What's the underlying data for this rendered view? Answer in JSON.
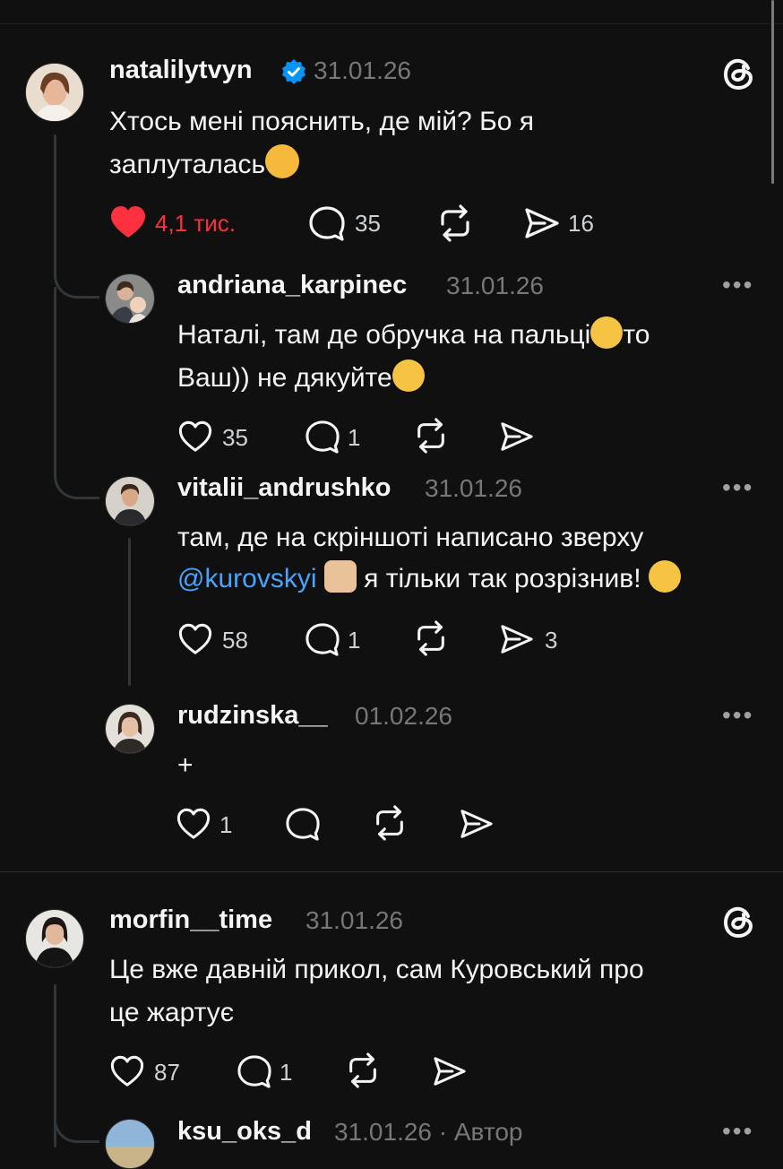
{
  "colors": {
    "background": "#101010",
    "text": "#f3f5f7",
    "muted": "#777777",
    "like_red": "#ff3040",
    "verified_blue": "#0095f6",
    "mention_blue": "#4aa3ff"
  },
  "threads": [
    {
      "username": "natalilytvyn",
      "verified": true,
      "date": "31.01.26",
      "text_line1": "Хтось мені пояснить, де мій? Бо я",
      "text_line2": "заплуталась",
      "emoji": "weary-face",
      "likes": "4,1 тис.",
      "replies": "35",
      "shares": "16",
      "liked": true,
      "comments": [
        {
          "username": "andriana_karpinec",
          "date": "31.01.26",
          "text_line1a": "Наталі, там де обручка на пальці",
          "text_line1b": "то",
          "text_line2": "Ваш)) не дякуйте",
          "likes": "35",
          "replies": "1"
        },
        {
          "username": "vitalii_andrushko",
          "date": "31.01.26",
          "text_line1": "там, де на скріншоті написано зверху",
          "mention": "@kurovskyi",
          "text_line2": "я тільки так розрізнив!",
          "likes": "58",
          "replies": "1",
          "shares": "3"
        },
        {
          "username": "rudzinska__",
          "date": "01.02.26",
          "text": "+",
          "likes": "1"
        }
      ]
    },
    {
      "username": "morfin__time",
      "date": "31.01.26",
      "text_line1": "Це вже давній прикол, сам Куровський про",
      "text_line2": "це жартує",
      "likes": "87",
      "replies": "1",
      "comments": [
        {
          "username": "ksu_oks_d",
          "date": "31.01.26",
          "suffix": "· Автор"
        }
      ]
    }
  ],
  "icons": {
    "threads_logo": "threads-logo-icon",
    "like": "heart-icon",
    "reply": "comment-bubble-icon",
    "repost": "repost-icon",
    "share": "send-icon",
    "more": "more-options-icon"
  }
}
